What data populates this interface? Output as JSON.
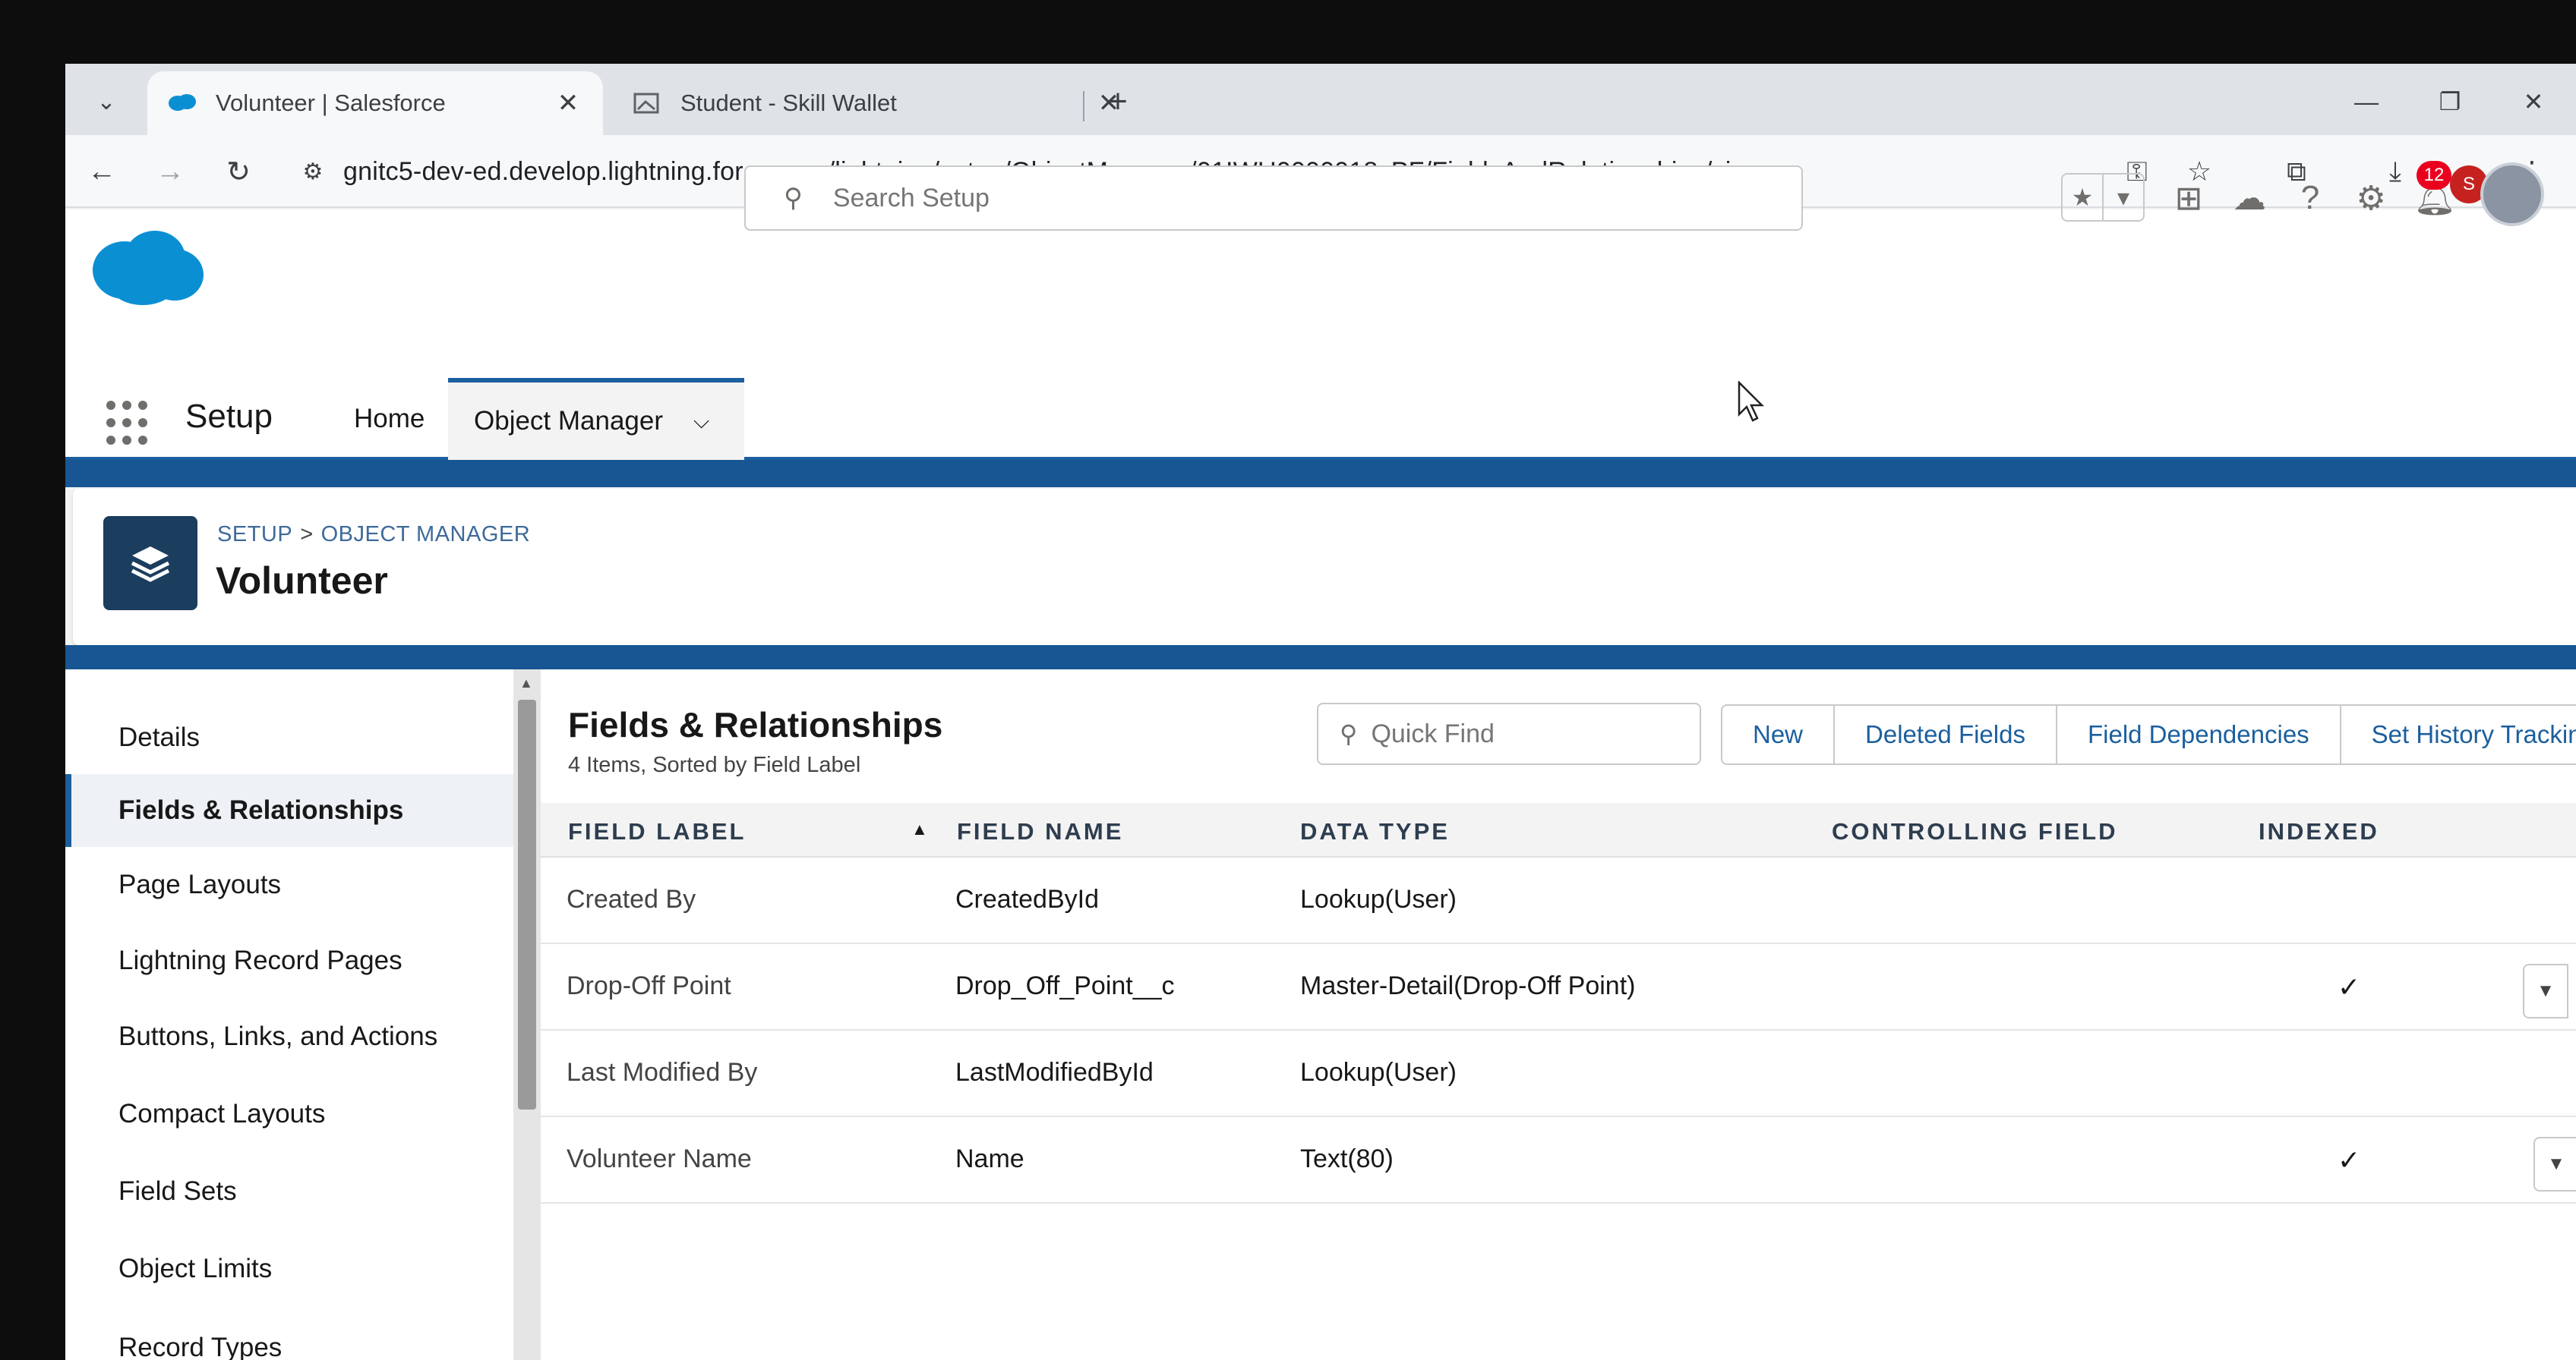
{
  "browser": {
    "tabs": [
      {
        "title": "Volunteer | Salesforce",
        "active": true
      },
      {
        "title": "Student - Skill Wallet",
        "active": false
      }
    ],
    "tab_close": "✕",
    "new_tab": "+",
    "url": "gnitc5-dev-ed.develop.lightning.force.com/lightning/setup/ObjectManager/01IWU0000018sPF/FieldsAndRelationships/view",
    "profile_initial": "S"
  },
  "header": {
    "search_placeholder": "Search Setup",
    "notification_count": "12"
  },
  "context": {
    "app_name": "Setup",
    "nav": [
      {
        "label": "Home"
      },
      {
        "label": "Object Manager"
      }
    ]
  },
  "page": {
    "breadcrumb": [
      "SETUP",
      "OBJECT MANAGER"
    ],
    "breadcrumb_sep": ">",
    "title": "Volunteer"
  },
  "sidebar": {
    "items": [
      {
        "label": "Details"
      },
      {
        "label": "Fields & Relationships"
      },
      {
        "label": "Page Layouts"
      },
      {
        "label": "Lightning Record Pages"
      },
      {
        "label": "Buttons, Links, and Actions"
      },
      {
        "label": "Compact Layouts"
      },
      {
        "label": "Field Sets"
      },
      {
        "label": "Object Limits"
      },
      {
        "label": "Record Types"
      }
    ]
  },
  "panel": {
    "title": "Fields & Relationships",
    "subtitle": "4 Items, Sorted by Field Label",
    "quick_find_placeholder": "Quick Find",
    "buttons": [
      "New",
      "Deleted Fields",
      "Field Dependencies",
      "Set History Tracking"
    ],
    "columns": [
      "FIELD LABEL",
      "FIELD NAME",
      "DATA TYPE",
      "CONTROLLING FIELD",
      "INDEXED"
    ],
    "rows": [
      {
        "label": "Created By",
        "name": "CreatedById",
        "type": "Lookup(User)",
        "controlling": "",
        "indexed": false
      },
      {
        "label": "Drop-Off Point",
        "name": "Drop_Off_Point__c",
        "type": "Master-Detail(Drop-Off Point)",
        "controlling": "",
        "indexed": true
      },
      {
        "label": "Last Modified By",
        "name": "LastModifiedById",
        "type": "Lookup(User)",
        "controlling": "",
        "indexed": false
      },
      {
        "label": "Volunteer Name",
        "name": "Name",
        "type": "Text(80)",
        "controlling": "",
        "indexed": true
      }
    ]
  },
  "colors": {
    "brand_blue": "#1b5f9e",
    "band_blue": "#175593",
    "salesforce_cloud": "#0b8fd3",
    "object_icon_bg": "#1b3d5e",
    "badge_red": "#ea001e"
  }
}
